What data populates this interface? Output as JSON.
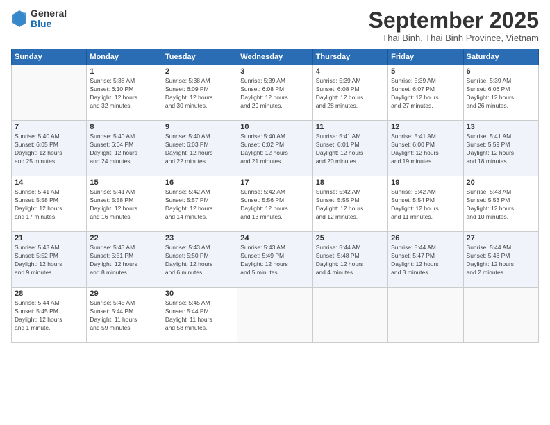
{
  "logo": {
    "general": "General",
    "blue": "Blue"
  },
  "title": "September 2025",
  "location": "Thai Binh, Thai Binh Province, Vietnam",
  "days_of_week": [
    "Sunday",
    "Monday",
    "Tuesday",
    "Wednesday",
    "Thursday",
    "Friday",
    "Saturday"
  ],
  "weeks": [
    [
      {
        "day": "",
        "info": ""
      },
      {
        "day": "1",
        "info": "Sunrise: 5:38 AM\nSunset: 6:10 PM\nDaylight: 12 hours\nand 32 minutes."
      },
      {
        "day": "2",
        "info": "Sunrise: 5:38 AM\nSunset: 6:09 PM\nDaylight: 12 hours\nand 30 minutes."
      },
      {
        "day": "3",
        "info": "Sunrise: 5:39 AM\nSunset: 6:08 PM\nDaylight: 12 hours\nand 29 minutes."
      },
      {
        "day": "4",
        "info": "Sunrise: 5:39 AM\nSunset: 6:08 PM\nDaylight: 12 hours\nand 28 minutes."
      },
      {
        "day": "5",
        "info": "Sunrise: 5:39 AM\nSunset: 6:07 PM\nDaylight: 12 hours\nand 27 minutes."
      },
      {
        "day": "6",
        "info": "Sunrise: 5:39 AM\nSunset: 6:06 PM\nDaylight: 12 hours\nand 26 minutes."
      }
    ],
    [
      {
        "day": "7",
        "info": "Sunrise: 5:40 AM\nSunset: 6:05 PM\nDaylight: 12 hours\nand 25 minutes."
      },
      {
        "day": "8",
        "info": "Sunrise: 5:40 AM\nSunset: 6:04 PM\nDaylight: 12 hours\nand 24 minutes."
      },
      {
        "day": "9",
        "info": "Sunrise: 5:40 AM\nSunset: 6:03 PM\nDaylight: 12 hours\nand 22 minutes."
      },
      {
        "day": "10",
        "info": "Sunrise: 5:40 AM\nSunset: 6:02 PM\nDaylight: 12 hours\nand 21 minutes."
      },
      {
        "day": "11",
        "info": "Sunrise: 5:41 AM\nSunset: 6:01 PM\nDaylight: 12 hours\nand 20 minutes."
      },
      {
        "day": "12",
        "info": "Sunrise: 5:41 AM\nSunset: 6:00 PM\nDaylight: 12 hours\nand 19 minutes."
      },
      {
        "day": "13",
        "info": "Sunrise: 5:41 AM\nSunset: 5:59 PM\nDaylight: 12 hours\nand 18 minutes."
      }
    ],
    [
      {
        "day": "14",
        "info": "Sunrise: 5:41 AM\nSunset: 5:58 PM\nDaylight: 12 hours\nand 17 minutes."
      },
      {
        "day": "15",
        "info": "Sunrise: 5:41 AM\nSunset: 5:58 PM\nDaylight: 12 hours\nand 16 minutes."
      },
      {
        "day": "16",
        "info": "Sunrise: 5:42 AM\nSunset: 5:57 PM\nDaylight: 12 hours\nand 14 minutes."
      },
      {
        "day": "17",
        "info": "Sunrise: 5:42 AM\nSunset: 5:56 PM\nDaylight: 12 hours\nand 13 minutes."
      },
      {
        "day": "18",
        "info": "Sunrise: 5:42 AM\nSunset: 5:55 PM\nDaylight: 12 hours\nand 12 minutes."
      },
      {
        "day": "19",
        "info": "Sunrise: 5:42 AM\nSunset: 5:54 PM\nDaylight: 12 hours\nand 11 minutes."
      },
      {
        "day": "20",
        "info": "Sunrise: 5:43 AM\nSunset: 5:53 PM\nDaylight: 12 hours\nand 10 minutes."
      }
    ],
    [
      {
        "day": "21",
        "info": "Sunrise: 5:43 AM\nSunset: 5:52 PM\nDaylight: 12 hours\nand 9 minutes."
      },
      {
        "day": "22",
        "info": "Sunrise: 5:43 AM\nSunset: 5:51 PM\nDaylight: 12 hours\nand 8 minutes."
      },
      {
        "day": "23",
        "info": "Sunrise: 5:43 AM\nSunset: 5:50 PM\nDaylight: 12 hours\nand 6 minutes."
      },
      {
        "day": "24",
        "info": "Sunrise: 5:43 AM\nSunset: 5:49 PM\nDaylight: 12 hours\nand 5 minutes."
      },
      {
        "day": "25",
        "info": "Sunrise: 5:44 AM\nSunset: 5:48 PM\nDaylight: 12 hours\nand 4 minutes."
      },
      {
        "day": "26",
        "info": "Sunrise: 5:44 AM\nSunset: 5:47 PM\nDaylight: 12 hours\nand 3 minutes."
      },
      {
        "day": "27",
        "info": "Sunrise: 5:44 AM\nSunset: 5:46 PM\nDaylight: 12 hours\nand 2 minutes."
      }
    ],
    [
      {
        "day": "28",
        "info": "Sunrise: 5:44 AM\nSunset: 5:45 PM\nDaylight: 12 hours\nand 1 minute."
      },
      {
        "day": "29",
        "info": "Sunrise: 5:45 AM\nSunset: 5:44 PM\nDaylight: 11 hours\nand 59 minutes."
      },
      {
        "day": "30",
        "info": "Sunrise: 5:45 AM\nSunset: 5:44 PM\nDaylight: 11 hours\nand 58 minutes."
      },
      {
        "day": "",
        "info": ""
      },
      {
        "day": "",
        "info": ""
      },
      {
        "day": "",
        "info": ""
      },
      {
        "day": "",
        "info": ""
      }
    ]
  ]
}
